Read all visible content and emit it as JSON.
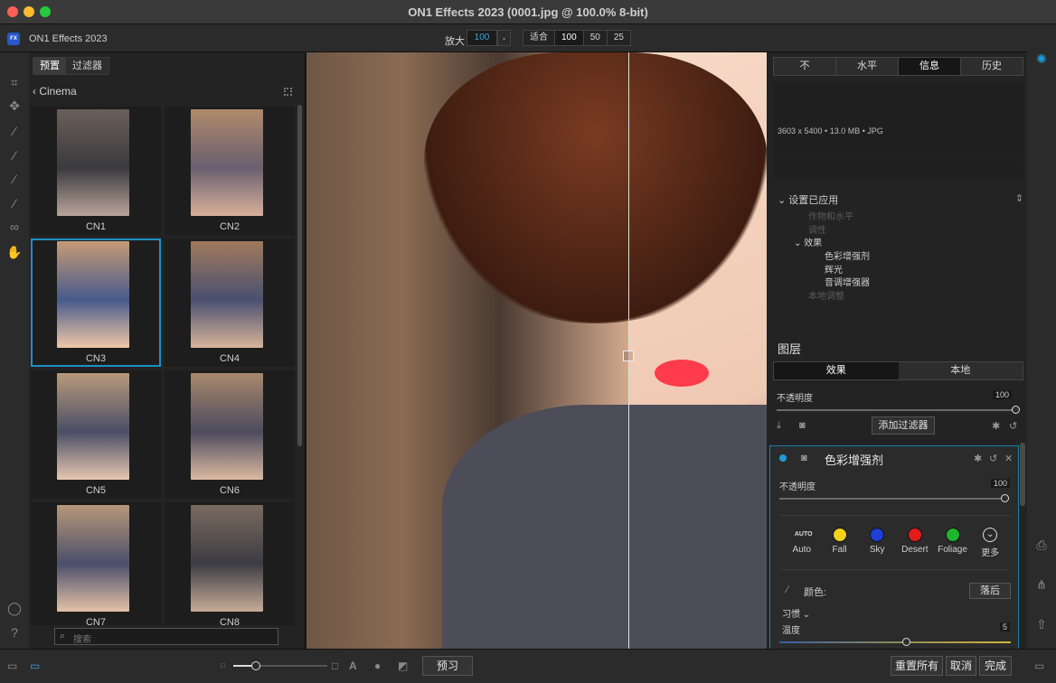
{
  "window": {
    "title": "ON1 Effects 2023 (0001.jpg @ 100.0% 8-bit)"
  },
  "toolbar": {
    "app_name": "ON1 Effects 2023",
    "logo_text": "FX",
    "zoom_label": "放大",
    "zoom_value": "100",
    "zoom_options": [
      "适合",
      "100",
      "50",
      "25"
    ]
  },
  "browser": {
    "tabs": [
      "预置",
      "过滤器"
    ],
    "breadcrumb": "Cinema",
    "presets": [
      {
        "label": "CN1"
      },
      {
        "label": "CN2"
      },
      {
        "label": "CN3"
      },
      {
        "label": "CN4"
      },
      {
        "label": "CN5"
      },
      {
        "label": "CN6"
      },
      {
        "label": "CN7"
      },
      {
        "label": "CN8"
      }
    ],
    "selected_preset": "CN3",
    "search_placeholder": "搜索"
  },
  "right_panel": {
    "tabs": [
      "不",
      "水平",
      "信息",
      "历史"
    ],
    "active_tab": "信息",
    "info_line": "3603 x 5400 • 13.0 MB • JPG",
    "settings_header": "设置已应用",
    "tree": [
      {
        "label": "作物和水平",
        "dim": true
      },
      {
        "label": "调性",
        "dim": true
      },
      {
        "label": "效果",
        "dim": false
      },
      {
        "label": "色彩增强剂",
        "dim": false
      },
      {
        "label": "辉光",
        "dim": false
      },
      {
        "label": "音调增强器",
        "dim": false
      },
      {
        "label": "本地调整",
        "dim": true
      }
    ],
    "layers_title": "图层",
    "layer_tabs": [
      "效果",
      "本地"
    ],
    "opacity_label": "不透明度",
    "opacity_value": "100",
    "add_filter_label": "添加过滤器",
    "filter": {
      "title": "色彩增强剂",
      "opacity_label": "不透明度",
      "opacity_value": "100",
      "presets": [
        {
          "label": "Auto",
          "color": "#d9d9d9"
        },
        {
          "label": "Fall",
          "color": "#f2d21b"
        },
        {
          "label": "Sky",
          "color": "#1f3fd6"
        },
        {
          "label": "Desert",
          "color": "#e21b1b"
        },
        {
          "label": "Foliage",
          "color": "#1fb52c"
        },
        {
          "label": "更多",
          "color": "#2b2b2b"
        }
      ],
      "color_label": "颜色:",
      "back_label": "落后",
      "habit_label": "习惯",
      "temperature_label": "温度",
      "temperature_value": "5"
    }
  },
  "bottom": {
    "preview_label": "预习",
    "reset_label": "重置所有",
    "cancel_label": "取消",
    "done_label": "完成"
  },
  "colors": {
    "accent": "#1d9bd8",
    "panel_bg": "#232323",
    "toolbar_bg": "#2b2b2b"
  }
}
